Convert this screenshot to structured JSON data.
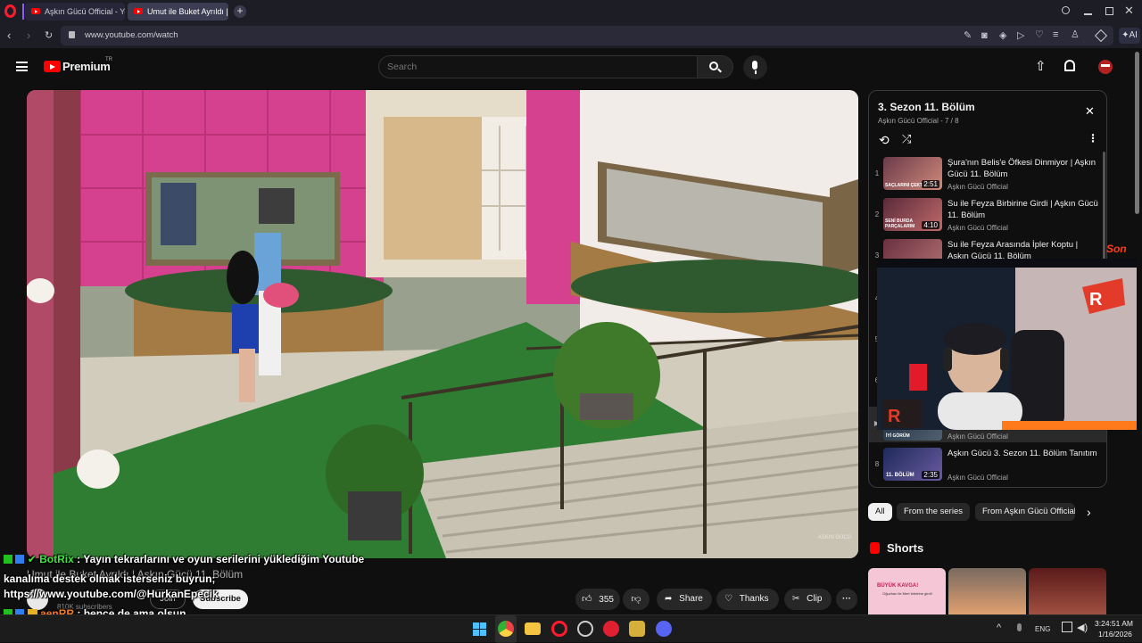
{
  "browser": {
    "tabs": [
      {
        "label": "Aşkın Gücü Official - YouTu"
      },
      {
        "label": "Umut ile Buket Ayrıldı | Aşk"
      }
    ],
    "url": "www.youtube.com/watch",
    "ai_label": "AI"
  },
  "header": {
    "logo_text": "Premium",
    "logo_region": "TR",
    "search_placeholder": "Search"
  },
  "video": {
    "title": "Umut ile Buket Ayrıldı | Aşkın Gücü 11. Bölüm",
    "channel_subs": "810K subscribers",
    "join_label": "Join",
    "subscribe_label": "Subscribe",
    "watermark": "ASKIN GÜCÜ",
    "actions": {
      "like_count": "355",
      "share_label": "Share",
      "thanks_label": "Thanks",
      "clip_label": "Clip"
    }
  },
  "playlist": {
    "title": "3. Sezon 11. Bölüm",
    "meta": "Aşkın Gücü Official - 7 / 8",
    "items": [
      {
        "num": "1",
        "title": "Şura'nın Belis'e Öfkesi Dinmiyor | Aşkın Gücü 11. Bölüm",
        "channel": "Aşkın Gücü Official",
        "duration": "2:51",
        "thumb_text": "SAÇLARINI ÇEKTİM"
      },
      {
        "num": "2",
        "title": "Su ile Feyza Birbirine Girdi | Aşkın Gücü 11. Bölüm",
        "channel": "Aşkın Gücü Official",
        "duration": "4:10",
        "thumb_text": "SENİ BURDA PARÇALARIM"
      },
      {
        "num": "3",
        "title": "Su ile Feyza Arasında İpler Koptu | Aşkın Gücü 11. Bölüm",
        "channel": "",
        "duration": "",
        "thumb_text": ""
      },
      {
        "num": "4"
      },
      {
        "num": "5"
      },
      {
        "num": "6"
      },
      {
        "num": "7",
        "channel": "Aşkın Gücü Official",
        "thumb_text": "İYİ GÖRÜM"
      },
      {
        "num": "8",
        "title": "Aşkın Gücü 3. Sezon 11. Bölüm Tanıtım",
        "channel": "Aşkın Gücü Official",
        "duration": "2:35",
        "thumb_text": "11. BÖLÜM"
      }
    ]
  },
  "webcam": {
    "edge_text": "Son"
  },
  "chips": [
    "All",
    "From the series",
    "From Aşkın Gücü Official"
  ],
  "shorts": {
    "title": "Shorts",
    "thumb_text": "BÜYÜK KAVGA!",
    "thumb_sub": "Oğuzhan ile Mert birbirine girdi!"
  },
  "chat": [
    {
      "user": "BotRix",
      "message": ": Yayın tekrarlarını ve oyun serilerini yüklediğim Youtube"
    },
    {
      "user": "",
      "message": "kanalıma destek olmak isterseniz buyrun;"
    },
    {
      "user": "",
      "message": "https://www.youtube.com/@HurkanEpecik"
    },
    {
      "user": "aenRR",
      "message": ": bence de ama olsun"
    }
  ],
  "taskbar": {
    "lang": "ENG",
    "time": "3:24:51 AM",
    "date": "1/16/2026"
  },
  "colors": {
    "brand_red": "#ff0000",
    "bg": "#0f0f0f",
    "chat_green": "#3ee83e",
    "chat_orange": "#ff7a1a"
  }
}
